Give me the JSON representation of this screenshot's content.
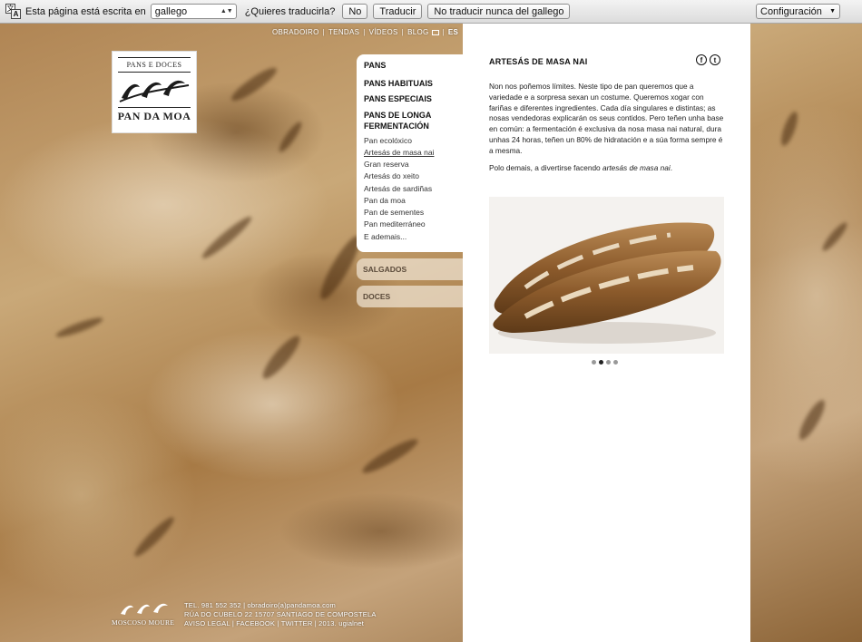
{
  "translate_bar": {
    "prefix": "Esta página está escrita en",
    "language": "gallego",
    "question": "¿Quieres traducirla?",
    "no_button": "No",
    "translate_button": "Traducir",
    "never_button": "No traducir nunca del gallego",
    "config": "Configuración"
  },
  "logo": {
    "top_text": "PANS E DOCES",
    "name": "PAN DA MOA"
  },
  "topnav": {
    "items": [
      "OBRADOIRO",
      "TENDAS",
      "VÍDEOS",
      "BLOG",
      "ES"
    ]
  },
  "menu": {
    "heading": "PANS",
    "categories": [
      "PANS HABITUAIS",
      "PANS ESPECIAIS",
      "PANS DE LONGA",
      "FERMENTACIÓN"
    ],
    "subitems": [
      "Pan ecolóxico",
      "Artesás de masa nai",
      "Gran reserva",
      "Artesás do xeito",
      "Artesás de sardiñas",
      "Pan da moa",
      "Pan de sementes",
      "Pan mediterráneo",
      "E ademais..."
    ],
    "tabs": [
      "SALGADOS",
      "DOCES"
    ]
  },
  "content": {
    "title": "ARTESÁS DE MASA NAI",
    "social": [
      "f",
      "t"
    ],
    "paragraph1": "Non nos poñemos límites. Neste tipo de pan queremos que a variedade e a sorpresa sexan un costume. Queremos xogar con fariñas e diferentes ingredientes. Cada día singulares e distintas; as nosas vendedoras explicarán os seus contidos. Pero teñen unha base en común: a fermentación é exclusiva da nosa masa nai natural, dura unhas 24 horas, teñen un 80% de hidratación e a súa forma sempre é a mesma.",
    "paragraph2_start": "Polo demais, a divertirse facendo ",
    "paragraph2_em": "artesás de masa nai",
    "paragraph2_end": ".",
    "slider_active_index": 1,
    "slider_count": 4
  },
  "footer": {
    "brand": "MOSCOSO MOURE",
    "line1": "TEL. 981 552 352  |  obradoiro(a)pandamoa.com",
    "line2": "RÚA DO CUBELO 22  15707 SANTIAGO DE COMPOSTELA",
    "line3": "AVISO LEGAL  |  FACEBOOK  |  TWITTER  |  2013. ugialnet"
  },
  "colors": {
    "bar_bg": "#e6e6e6",
    "panel_bg": "#ffffff",
    "text": "#222222",
    "accent_bread": "#b08554"
  }
}
